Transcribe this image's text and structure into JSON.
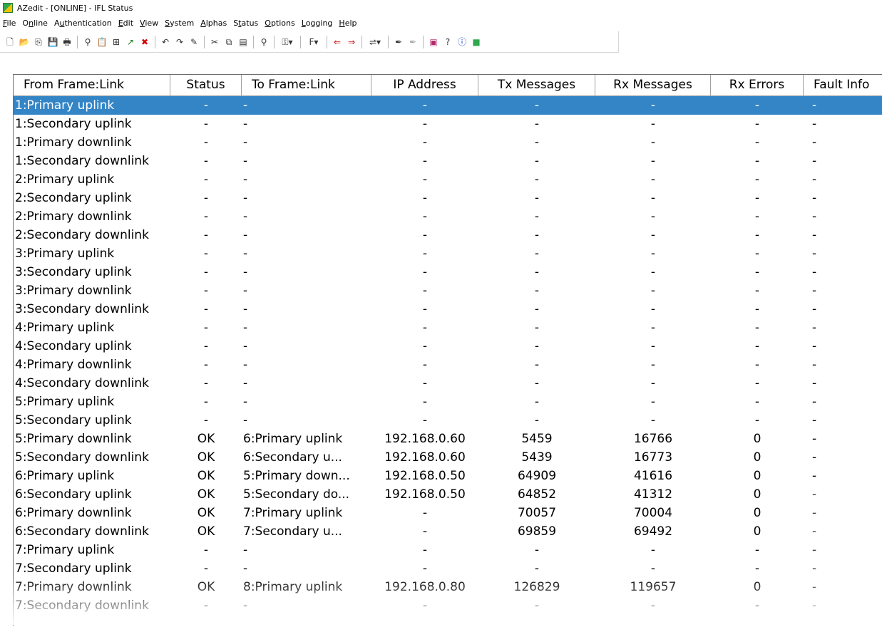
{
  "window": {
    "title": "AZedit - [ONLINE] - IFL Status"
  },
  "menu": [
    {
      "pre": "",
      "acc": "F",
      "post": "ile"
    },
    {
      "pre": "O",
      "acc": "n",
      "post": "line"
    },
    {
      "pre": "A",
      "acc": "u",
      "post": "thentication"
    },
    {
      "pre": "",
      "acc": "E",
      "post": "dit"
    },
    {
      "pre": "",
      "acc": "V",
      "post": "iew"
    },
    {
      "pre": "",
      "acc": "S",
      "post": "ystem"
    },
    {
      "pre": "",
      "acc": "A",
      "post": "lphas"
    },
    {
      "pre": "S",
      "acc": "t",
      "post": "atus"
    },
    {
      "pre": "",
      "acc": "O",
      "post": "ptions"
    },
    {
      "pre": "",
      "acc": "L",
      "post": "ogging"
    },
    {
      "pre": "",
      "acc": "H",
      "post": "elp"
    }
  ],
  "toolbar": {
    "icons": [
      "new-file-icon",
      "open-folder-icon",
      "copy-icon",
      "save-icon",
      "print-icon",
      "sep",
      "connect-icon",
      "paste-icon",
      "tree-icon",
      "trend-up-icon",
      "close-red-icon",
      "sep",
      "undo-icon",
      "redo-icon",
      "pencil-icon",
      "sep",
      "cut-icon",
      "copy-doc-icon",
      "paste-doc-icon",
      "sep",
      "magnifier-icon",
      "sep",
      "key-dropdown-icon",
      "sep",
      "font-dropdown-icon",
      "sep",
      "arrow-left-icon",
      "arrow-right-icon",
      "sep",
      "network-dropdown-icon",
      "sep",
      "pen-icon",
      "pen-disabled-icon",
      "sep",
      "book-icon",
      "help-cursor-icon",
      "info-icon",
      "app-logo-icon"
    ]
  },
  "table": {
    "columns": [
      "From Frame:Link",
      "Status",
      "To Frame:Link",
      "IP Address",
      "Tx Messages",
      "Rx Messages",
      "Rx Errors",
      "Fault Info"
    ],
    "selected_row": 0,
    "rows": [
      [
        "1:Primary uplink",
        "-",
        "-",
        "-",
        "-",
        "-",
        "-",
        "-"
      ],
      [
        "1:Secondary uplink",
        "-",
        "-",
        "-",
        "-",
        "-",
        "-",
        "-"
      ],
      [
        "1:Primary downlink",
        "-",
        "-",
        "-",
        "-",
        "-",
        "-",
        "-"
      ],
      [
        "1:Secondary downlink",
        "-",
        "-",
        "-",
        "-",
        "-",
        "-",
        "-"
      ],
      [
        "2:Primary uplink",
        "-",
        "-",
        "-",
        "-",
        "-",
        "-",
        "-"
      ],
      [
        "2:Secondary uplink",
        "-",
        "-",
        "-",
        "-",
        "-",
        "-",
        "-"
      ],
      [
        "2:Primary downlink",
        "-",
        "-",
        "-",
        "-",
        "-",
        "-",
        "-"
      ],
      [
        "2:Secondary downlink",
        "-",
        "-",
        "-",
        "-",
        "-",
        "-",
        "-"
      ],
      [
        "3:Primary uplink",
        "-",
        "-",
        "-",
        "-",
        "-",
        "-",
        "-"
      ],
      [
        "3:Secondary uplink",
        "-",
        "-",
        "-",
        "-",
        "-",
        "-",
        "-"
      ],
      [
        "3:Primary downlink",
        "-",
        "-",
        "-",
        "-",
        "-",
        "-",
        "-"
      ],
      [
        "3:Secondary downlink",
        "-",
        "-",
        "-",
        "-",
        "-",
        "-",
        "-"
      ],
      [
        "4:Primary uplink",
        "-",
        "-",
        "-",
        "-",
        "-",
        "-",
        "-"
      ],
      [
        "4:Secondary uplink",
        "-",
        "-",
        "-",
        "-",
        "-",
        "-",
        "-"
      ],
      [
        "4:Primary downlink",
        "-",
        "-",
        "-",
        "-",
        "-",
        "-",
        "-"
      ],
      [
        "4:Secondary downlink",
        "-",
        "-",
        "-",
        "-",
        "-",
        "-",
        "-"
      ],
      [
        "5:Primary uplink",
        "-",
        "-",
        "-",
        "-",
        "-",
        "-",
        "-"
      ],
      [
        "5:Secondary uplink",
        "-",
        "-",
        "-",
        "-",
        "-",
        "-",
        "-"
      ],
      [
        "5:Primary downlink",
        "OK",
        "6:Primary uplink",
        "192.168.0.60",
        "5459",
        "16766",
        "0",
        "-"
      ],
      [
        "5:Secondary downlink",
        "OK",
        "6:Secondary u...",
        "192.168.0.60",
        "5439",
        "16773",
        "0",
        "-"
      ],
      [
        "6:Primary uplink",
        "OK",
        "5:Primary down...",
        "192.168.0.50",
        "64909",
        "41616",
        "0",
        "-"
      ],
      [
        "6:Secondary uplink",
        "OK",
        "5:Secondary do...",
        "192.168.0.50",
        "64852",
        "41312",
        "0",
        "-"
      ],
      [
        "6:Primary downlink",
        "OK",
        "7:Primary uplink",
        "-",
        "70057",
        "70004",
        "0",
        "-"
      ],
      [
        "6:Secondary downlink",
        "OK",
        "7:Secondary u...",
        "-",
        "69859",
        "69492",
        "0",
        "-"
      ],
      [
        "7:Primary uplink",
        "-",
        "-",
        "-",
        "-",
        "-",
        "-",
        "-"
      ],
      [
        "7:Secondary uplink",
        "-",
        "-",
        "-",
        "-",
        "-",
        "-",
        "-"
      ],
      [
        "7:Primary downlink",
        "OK",
        "8:Primary uplink",
        "192.168.0.80",
        "126829",
        "119657",
        "0",
        "-"
      ],
      [
        "7:Secondary downlink",
        "-",
        "-",
        "-",
        "-",
        "-",
        "-",
        "-"
      ]
    ]
  }
}
